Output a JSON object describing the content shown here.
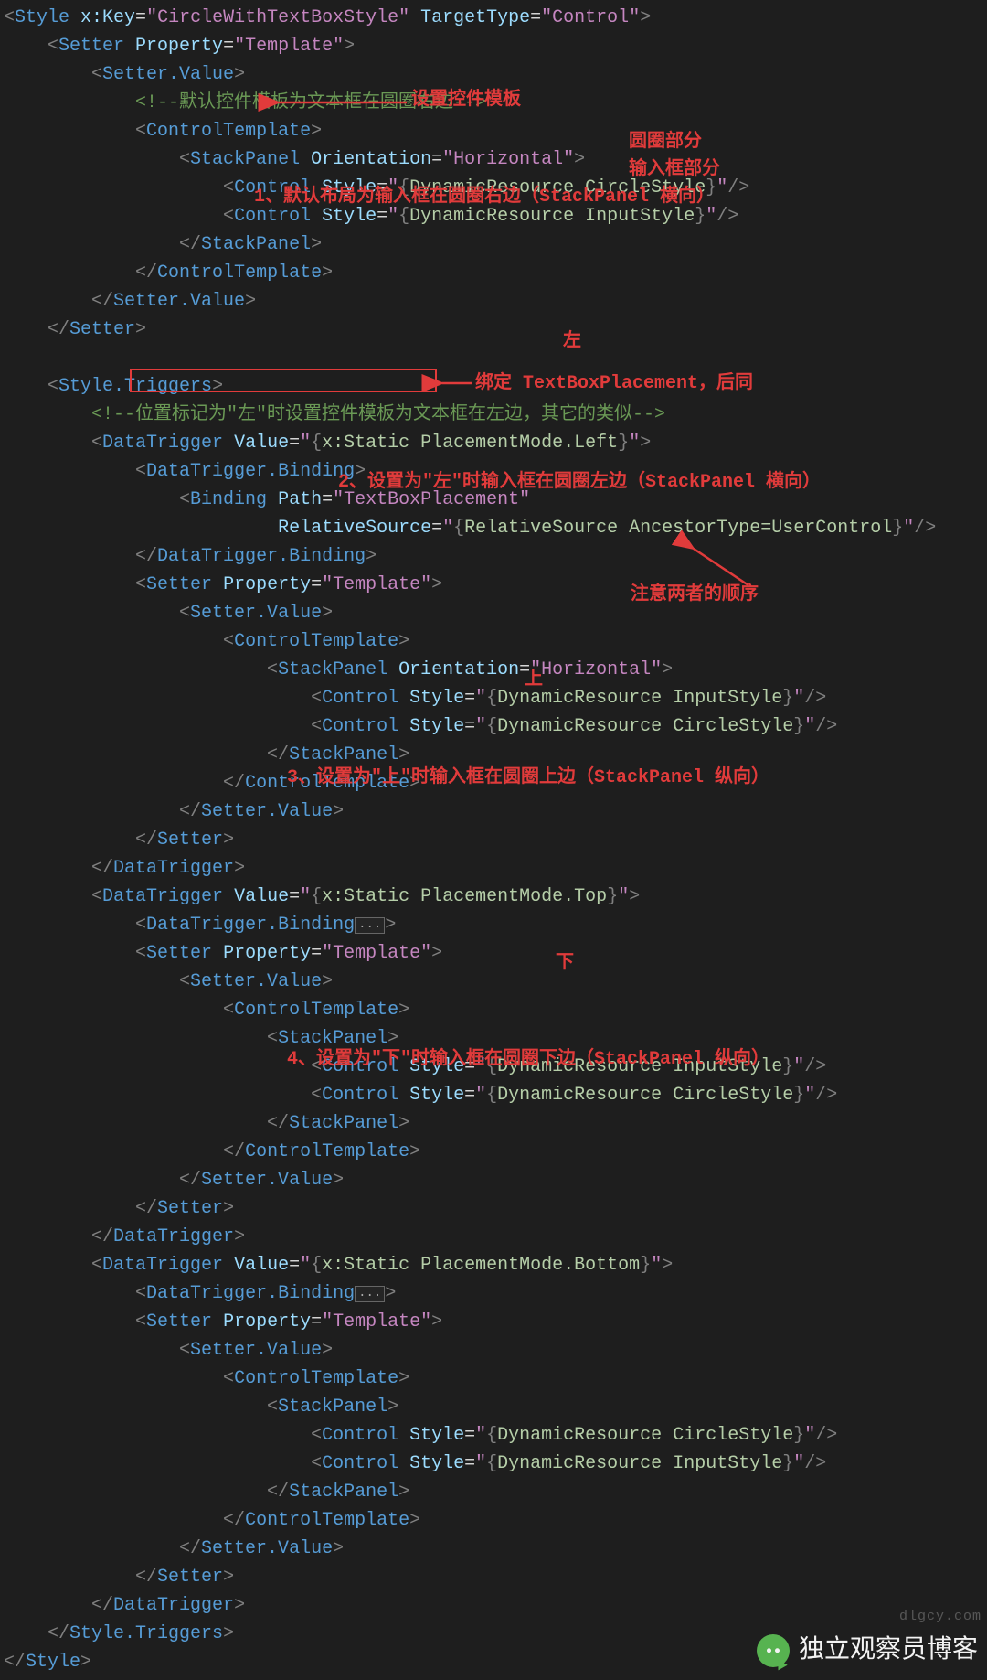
{
  "lines": [
    [
      [
        0,
        "gray",
        "<"
      ],
      [
        0,
        "tag",
        "Style "
      ],
      [
        0,
        "attrname",
        "x:Key"
      ],
      [
        0,
        "eq",
        "="
      ],
      [
        0,
        "string",
        "\"CircleWithTextBoxStyle\""
      ],
      [
        0,
        "tag",
        " "
      ],
      [
        0,
        "attrname",
        "TargetType"
      ],
      [
        0,
        "eq",
        "="
      ],
      [
        0,
        "string",
        "\"Control\""
      ],
      [
        0,
        "gray",
        ">"
      ]
    ],
    [
      [
        1,
        "gray",
        "<"
      ],
      [
        0,
        "tag",
        "Setter "
      ],
      [
        0,
        "attrname",
        "Property"
      ],
      [
        0,
        "eq",
        "="
      ],
      [
        0,
        "string",
        "\"Template\""
      ],
      [
        0,
        "gray",
        ">"
      ]
    ],
    [
      [
        2,
        "gray",
        "<"
      ],
      [
        0,
        "tag",
        "Setter.Value"
      ],
      [
        0,
        "gray",
        ">"
      ]
    ],
    [
      [
        3,
        "comment",
        "<!--默认控件模板为文本框在圆圈右边-->"
      ]
    ],
    [
      [
        3,
        "gray",
        "<"
      ],
      [
        0,
        "tag",
        "ControlTemplate"
      ],
      [
        0,
        "gray",
        ">"
      ]
    ],
    [
      [
        4,
        "gray",
        "<"
      ],
      [
        0,
        "tag",
        "StackPanel "
      ],
      [
        0,
        "attrname",
        "Orientation"
      ],
      [
        0,
        "eq",
        "="
      ],
      [
        0,
        "string",
        "\"Horizontal\""
      ],
      [
        0,
        "gray",
        ">"
      ]
    ],
    [
      [
        5,
        "gray",
        "<"
      ],
      [
        0,
        "tag",
        "Control "
      ],
      [
        0,
        "attrname",
        "Style"
      ],
      [
        0,
        "eq",
        "="
      ],
      [
        0,
        "string",
        "\""
      ],
      [
        0,
        "gray",
        "{"
      ],
      [
        0,
        "binding",
        "DynamicResource CircleStyle"
      ],
      [
        0,
        "gray",
        "}"
      ],
      [
        0,
        "string",
        "\""
      ],
      [
        0,
        "gray",
        "/>"
      ]
    ],
    [
      [
        5,
        "gray",
        "<"
      ],
      [
        0,
        "tag",
        "Control "
      ],
      [
        0,
        "attrname",
        "Style"
      ],
      [
        0,
        "eq",
        "="
      ],
      [
        0,
        "string",
        "\""
      ],
      [
        0,
        "gray",
        "{"
      ],
      [
        0,
        "binding",
        "DynamicResource InputStyle"
      ],
      [
        0,
        "gray",
        "}"
      ],
      [
        0,
        "string",
        "\""
      ],
      [
        0,
        "gray",
        "/>"
      ]
    ],
    [
      [
        4,
        "gray",
        "</"
      ],
      [
        0,
        "tag",
        "StackPanel"
      ],
      [
        0,
        "gray",
        ">"
      ]
    ],
    [
      [
        3,
        "gray",
        "</"
      ],
      [
        0,
        "tag",
        "ControlTemplate"
      ],
      [
        0,
        "gray",
        ">"
      ]
    ],
    [
      [
        2,
        "gray",
        "</"
      ],
      [
        0,
        "tag",
        "Setter.Value"
      ],
      [
        0,
        "gray",
        ">"
      ]
    ],
    [
      [
        1,
        "gray",
        "</"
      ],
      [
        0,
        "tag",
        "Setter"
      ],
      [
        0,
        "gray",
        ">"
      ]
    ],
    [
      [
        0,
        "",
        ""
      ]
    ],
    [
      [
        1,
        "gray",
        "<"
      ],
      [
        0,
        "tag",
        "Style.Triggers"
      ],
      [
        0,
        "gray",
        ">"
      ]
    ],
    [
      [
        2,
        "comment",
        "<!--位置标记为\"左\"时设置控件模板为文本框在左边，其它的类似-->"
      ]
    ],
    [
      [
        2,
        "gray",
        "<"
      ],
      [
        0,
        "tag",
        "DataTrigger "
      ],
      [
        0,
        "attrname",
        "Value"
      ],
      [
        0,
        "eq",
        "="
      ],
      [
        0,
        "string",
        "\""
      ],
      [
        0,
        "gray",
        "{"
      ],
      [
        0,
        "binding",
        "x:Static PlacementMode.Left"
      ],
      [
        0,
        "gray",
        "}"
      ],
      [
        0,
        "string",
        "\""
      ],
      [
        0,
        "gray",
        ">"
      ]
    ],
    [
      [
        3,
        "gray",
        "<"
      ],
      [
        0,
        "tag",
        "DataTrigger.Binding"
      ],
      [
        0,
        "gray",
        ">"
      ]
    ],
    [
      [
        4,
        "gray",
        "<"
      ],
      [
        0,
        "tag",
        "Binding "
      ],
      [
        0,
        "attrname",
        "Path"
      ],
      [
        0,
        "eq",
        "="
      ],
      [
        0,
        "string",
        "\"TextBoxPlacement\""
      ]
    ],
    [
      [
        4,
        "eq",
        "         "
      ],
      [
        0,
        "attrname",
        "RelativeSource"
      ],
      [
        0,
        "eq",
        "="
      ],
      [
        0,
        "string",
        "\""
      ],
      [
        0,
        "gray",
        "{"
      ],
      [
        0,
        "binding",
        "RelativeSource AncestorType=UserControl"
      ],
      [
        0,
        "gray",
        "}"
      ],
      [
        0,
        "string",
        "\""
      ],
      [
        0,
        "gray",
        "/>"
      ]
    ],
    [
      [
        3,
        "gray",
        "</"
      ],
      [
        0,
        "tag",
        "DataTrigger.Binding"
      ],
      [
        0,
        "gray",
        ">"
      ]
    ],
    [
      [
        3,
        "gray",
        "<"
      ],
      [
        0,
        "tag",
        "Setter "
      ],
      [
        0,
        "attrname",
        "Property"
      ],
      [
        0,
        "eq",
        "="
      ],
      [
        0,
        "string",
        "\"Template\""
      ],
      [
        0,
        "gray",
        ">"
      ]
    ],
    [
      [
        4,
        "gray",
        "<"
      ],
      [
        0,
        "tag",
        "Setter.Value"
      ],
      [
        0,
        "gray",
        ">"
      ]
    ],
    [
      [
        5,
        "gray",
        "<"
      ],
      [
        0,
        "tag",
        "ControlTemplate"
      ],
      [
        0,
        "gray",
        ">"
      ]
    ],
    [
      [
        6,
        "gray",
        "<"
      ],
      [
        0,
        "tag",
        "StackPanel "
      ],
      [
        0,
        "attrname",
        "Orientation"
      ],
      [
        0,
        "eq",
        "="
      ],
      [
        0,
        "string",
        "\"Horizontal\""
      ],
      [
        0,
        "gray",
        ">"
      ]
    ],
    [
      [
        7,
        "gray",
        "<"
      ],
      [
        0,
        "tag",
        "Control "
      ],
      [
        0,
        "attrname",
        "Style"
      ],
      [
        0,
        "eq",
        "="
      ],
      [
        0,
        "string",
        "\""
      ],
      [
        0,
        "gray",
        "{"
      ],
      [
        0,
        "binding",
        "DynamicResource InputStyle"
      ],
      [
        0,
        "gray",
        "}"
      ],
      [
        0,
        "string",
        "\""
      ],
      [
        0,
        "gray",
        "/>"
      ]
    ],
    [
      [
        7,
        "gray",
        "<"
      ],
      [
        0,
        "tag",
        "Control "
      ],
      [
        0,
        "attrname",
        "Style"
      ],
      [
        0,
        "eq",
        "="
      ],
      [
        0,
        "string",
        "\""
      ],
      [
        0,
        "gray",
        "{"
      ],
      [
        0,
        "binding",
        "DynamicResource CircleStyle"
      ],
      [
        0,
        "gray",
        "}"
      ],
      [
        0,
        "string",
        "\""
      ],
      [
        0,
        "gray",
        "/>"
      ]
    ],
    [
      [
        6,
        "gray",
        "</"
      ],
      [
        0,
        "tag",
        "StackPanel"
      ],
      [
        0,
        "gray",
        ">"
      ]
    ],
    [
      [
        5,
        "gray",
        "</"
      ],
      [
        0,
        "tag",
        "ControlTemplate"
      ],
      [
        0,
        "gray",
        ">"
      ]
    ],
    [
      [
        4,
        "gray",
        "</"
      ],
      [
        0,
        "tag",
        "Setter.Value"
      ],
      [
        0,
        "gray",
        ">"
      ]
    ],
    [
      [
        3,
        "gray",
        "</"
      ],
      [
        0,
        "tag",
        "Setter"
      ],
      [
        0,
        "gray",
        ">"
      ]
    ],
    [
      [
        2,
        "gray",
        "</"
      ],
      [
        0,
        "tag",
        "DataTrigger"
      ],
      [
        0,
        "gray",
        ">"
      ]
    ],
    [
      [
        2,
        "gray",
        "<"
      ],
      [
        0,
        "tag",
        "DataTrigger "
      ],
      [
        0,
        "attrname",
        "Value"
      ],
      [
        0,
        "eq",
        "="
      ],
      [
        0,
        "string",
        "\""
      ],
      [
        0,
        "gray",
        "{"
      ],
      [
        0,
        "binding",
        "x:Static PlacementMode.Top"
      ],
      [
        0,
        "gray",
        "}"
      ],
      [
        0,
        "string",
        "\""
      ],
      [
        0,
        "gray",
        ">"
      ]
    ],
    [
      [
        3,
        "gray",
        "<"
      ],
      [
        0,
        "tag",
        "DataTrigger.Binding"
      ],
      [
        0,
        "fold",
        "..."
      ],
      [
        0,
        "gray",
        ">"
      ]
    ],
    [
      [
        3,
        "gray",
        "<"
      ],
      [
        0,
        "tag",
        "Setter "
      ],
      [
        0,
        "attrname",
        "Property"
      ],
      [
        0,
        "eq",
        "="
      ],
      [
        0,
        "string",
        "\"Template\""
      ],
      [
        0,
        "gray",
        ">"
      ]
    ],
    [
      [
        4,
        "gray",
        "<"
      ],
      [
        0,
        "tag",
        "Setter.Value"
      ],
      [
        0,
        "gray",
        ">"
      ]
    ],
    [
      [
        5,
        "gray",
        "<"
      ],
      [
        0,
        "tag",
        "ControlTemplate"
      ],
      [
        0,
        "gray",
        ">"
      ]
    ],
    [
      [
        6,
        "gray",
        "<"
      ],
      [
        0,
        "tag",
        "StackPanel"
      ],
      [
        0,
        "gray",
        ">"
      ]
    ],
    [
      [
        7,
        "gray",
        "<"
      ],
      [
        0,
        "tag",
        "Control "
      ],
      [
        0,
        "attrname",
        "Style"
      ],
      [
        0,
        "eq",
        "="
      ],
      [
        0,
        "string",
        "\""
      ],
      [
        0,
        "gray",
        "{"
      ],
      [
        0,
        "binding",
        "DynamicResource InputStyle"
      ],
      [
        0,
        "gray",
        "}"
      ],
      [
        0,
        "string",
        "\""
      ],
      [
        0,
        "gray",
        "/>"
      ]
    ],
    [
      [
        7,
        "gray",
        "<"
      ],
      [
        0,
        "tag",
        "Control "
      ],
      [
        0,
        "attrname",
        "Style"
      ],
      [
        0,
        "eq",
        "="
      ],
      [
        0,
        "string",
        "\""
      ],
      [
        0,
        "gray",
        "{"
      ],
      [
        0,
        "binding",
        "DynamicResource CircleStyle"
      ],
      [
        0,
        "gray",
        "}"
      ],
      [
        0,
        "string",
        "\""
      ],
      [
        0,
        "gray",
        "/>"
      ]
    ],
    [
      [
        6,
        "gray",
        "</"
      ],
      [
        0,
        "tag",
        "StackPanel"
      ],
      [
        0,
        "gray",
        ">"
      ]
    ],
    [
      [
        5,
        "gray",
        "</"
      ],
      [
        0,
        "tag",
        "ControlTemplate"
      ],
      [
        0,
        "gray",
        ">"
      ]
    ],
    [
      [
        4,
        "gray",
        "</"
      ],
      [
        0,
        "tag",
        "Setter.Value"
      ],
      [
        0,
        "gray",
        ">"
      ]
    ],
    [
      [
        3,
        "gray",
        "</"
      ],
      [
        0,
        "tag",
        "Setter"
      ],
      [
        0,
        "gray",
        ">"
      ]
    ],
    [
      [
        2,
        "gray",
        "</"
      ],
      [
        0,
        "tag",
        "DataTrigger"
      ],
      [
        0,
        "gray",
        ">"
      ]
    ],
    [
      [
        2,
        "gray",
        "<"
      ],
      [
        0,
        "tag",
        "DataTrigger "
      ],
      [
        0,
        "attrname",
        "Value"
      ],
      [
        0,
        "eq",
        "="
      ],
      [
        0,
        "string",
        "\""
      ],
      [
        0,
        "gray",
        "{"
      ],
      [
        0,
        "binding",
        "x:Static PlacementMode.Bottom"
      ],
      [
        0,
        "gray",
        "}"
      ],
      [
        0,
        "string",
        "\""
      ],
      [
        0,
        "gray",
        ">"
      ]
    ],
    [
      [
        3,
        "gray",
        "<"
      ],
      [
        0,
        "tag",
        "DataTrigger.Binding"
      ],
      [
        0,
        "fold",
        "..."
      ],
      [
        0,
        "gray",
        ">"
      ]
    ],
    [
      [
        3,
        "gray",
        "<"
      ],
      [
        0,
        "tag",
        "Setter "
      ],
      [
        0,
        "attrname",
        "Property"
      ],
      [
        0,
        "eq",
        "="
      ],
      [
        0,
        "string",
        "\"Template\""
      ],
      [
        0,
        "gray",
        ">"
      ]
    ],
    [
      [
        4,
        "gray",
        "<"
      ],
      [
        0,
        "tag",
        "Setter.Value"
      ],
      [
        0,
        "gray",
        ">"
      ]
    ],
    [
      [
        5,
        "gray",
        "<"
      ],
      [
        0,
        "tag",
        "ControlTemplate"
      ],
      [
        0,
        "gray",
        ">"
      ]
    ],
    [
      [
        6,
        "gray",
        "<"
      ],
      [
        0,
        "tag",
        "StackPanel"
      ],
      [
        0,
        "gray",
        ">"
      ]
    ],
    [
      [
        7,
        "gray",
        "<"
      ],
      [
        0,
        "tag",
        "Control "
      ],
      [
        0,
        "attrname",
        "Style"
      ],
      [
        0,
        "eq",
        "="
      ],
      [
        0,
        "string",
        "\""
      ],
      [
        0,
        "gray",
        "{"
      ],
      [
        0,
        "binding",
        "DynamicResource CircleStyle"
      ],
      [
        0,
        "gray",
        "}"
      ],
      [
        0,
        "string",
        "\""
      ],
      [
        0,
        "gray",
        "/>"
      ]
    ],
    [
      [
        7,
        "gray",
        "<"
      ],
      [
        0,
        "tag",
        "Control "
      ],
      [
        0,
        "attrname",
        "Style"
      ],
      [
        0,
        "eq",
        "="
      ],
      [
        0,
        "string",
        "\""
      ],
      [
        0,
        "gray",
        "{"
      ],
      [
        0,
        "binding",
        "DynamicResource InputStyle"
      ],
      [
        0,
        "gray",
        "}"
      ],
      [
        0,
        "string",
        "\""
      ],
      [
        0,
        "gray",
        "/>"
      ]
    ],
    [
      [
        6,
        "gray",
        "</"
      ],
      [
        0,
        "tag",
        "StackPanel"
      ],
      [
        0,
        "gray",
        ">"
      ]
    ],
    [
      [
        5,
        "gray",
        "</"
      ],
      [
        0,
        "tag",
        "ControlTemplate"
      ],
      [
        0,
        "gray",
        ">"
      ]
    ],
    [
      [
        4,
        "gray",
        "</"
      ],
      [
        0,
        "tag",
        "Setter.Value"
      ],
      [
        0,
        "gray",
        ">"
      ]
    ],
    [
      [
        3,
        "gray",
        "</"
      ],
      [
        0,
        "tag",
        "Setter"
      ],
      [
        0,
        "gray",
        ">"
      ]
    ],
    [
      [
        2,
        "gray",
        "</"
      ],
      [
        0,
        "tag",
        "DataTrigger"
      ],
      [
        0,
        "gray",
        ">"
      ]
    ],
    [
      [
        1,
        "gray",
        "</"
      ],
      [
        0,
        "tag",
        "Style.Triggers"
      ],
      [
        0,
        "gray",
        ">"
      ]
    ],
    [
      [
        0,
        "gray",
        "</"
      ],
      [
        0,
        "tag",
        "Style"
      ],
      [
        0,
        "gray",
        ">"
      ]
    ]
  ],
  "annotations": {
    "a0": "设置控件模板",
    "a1": "圆圈部分",
    "a2": "输入框部分",
    "a3": "1、默认布局为输入框在圆圈右边（StackPanel 横向）",
    "a4": "左",
    "a5": "绑定 TextBoxPlacement，后同",
    "a6": "2、设置为\"左\"时输入框在圆圈左边（StackPanel 横向）",
    "a7": "注意两者的顺序",
    "a8": "上",
    "a9": "3、设置为\"上\"时输入框在圆圈上边（StackPanel 纵向）",
    "a10": "下",
    "a11": "4、设置为\"下\"时输入框在圆圈下边（StackPanel 纵向）"
  },
  "watermark": "独立观察员博客",
  "watermark_small": "dlgcy.com"
}
